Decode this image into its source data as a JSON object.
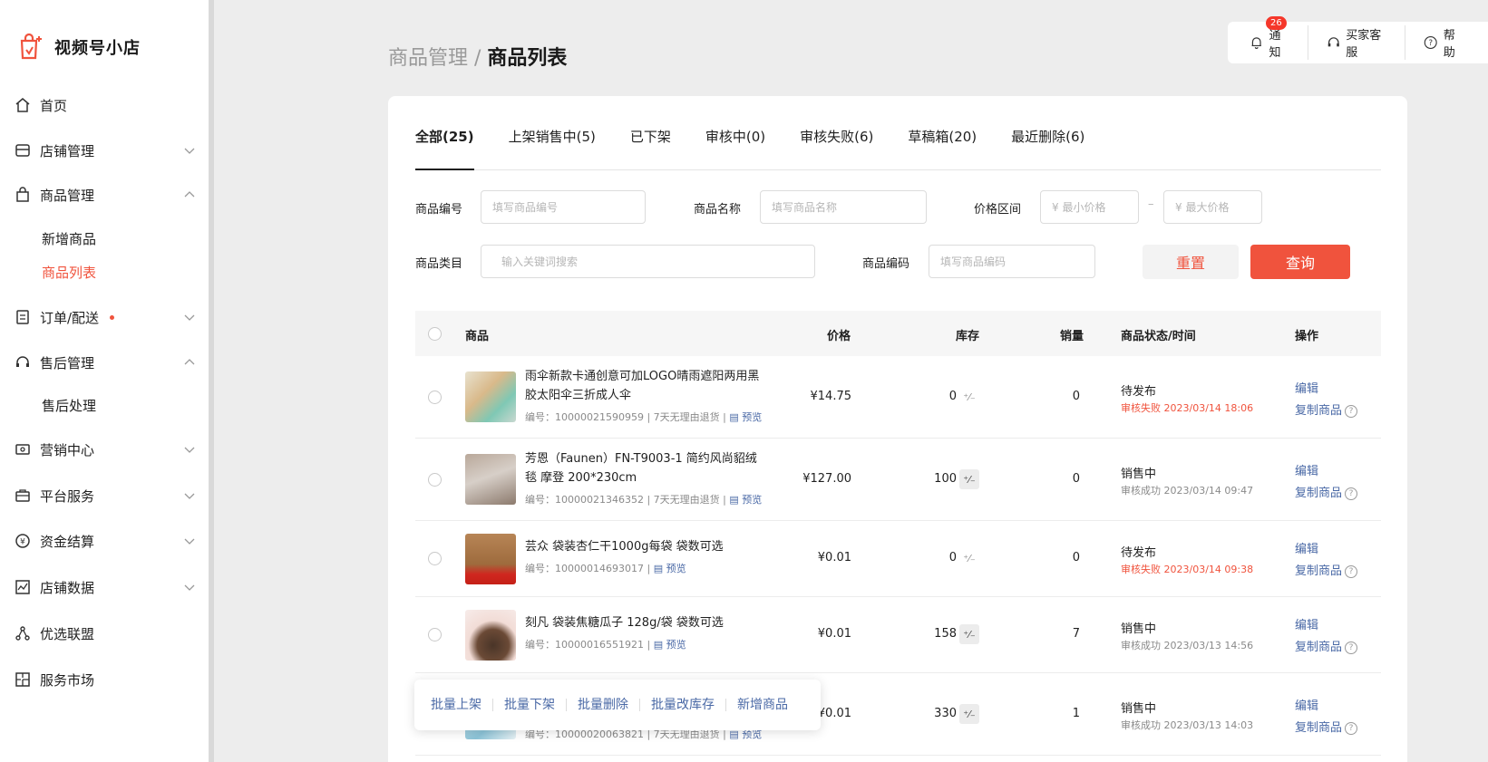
{
  "brand": {
    "name": "视频号小店"
  },
  "sidebar": {
    "items": [
      {
        "label": "首页"
      },
      {
        "label": "店铺管理"
      },
      {
        "label": "商品管理"
      },
      {
        "label": "订单/配送"
      },
      {
        "label": "售后管理"
      },
      {
        "label": "营销中心"
      },
      {
        "label": "平台服务"
      },
      {
        "label": "资金结算"
      },
      {
        "label": "店铺数据"
      },
      {
        "label": "优选联盟"
      },
      {
        "label": "服务市场"
      }
    ],
    "sub": {
      "product": [
        {
          "label": "新增商品"
        },
        {
          "label": "商品列表"
        }
      ],
      "aftersale": [
        {
          "label": "售后处理"
        }
      ]
    }
  },
  "topbar": {
    "notice": "通知",
    "notice_count": "26",
    "service": "买家客服",
    "help": "帮助"
  },
  "breadcrumb": {
    "parent": "商品管理",
    "sep": " / ",
    "current": "商品列表"
  },
  "tabs": [
    {
      "label": "全部(25)"
    },
    {
      "label": "上架销售中(5)"
    },
    {
      "label": "已下架"
    },
    {
      "label": "审核中(0)"
    },
    {
      "label": "审核失败(6)"
    },
    {
      "label": "草稿箱(20)"
    },
    {
      "label": "最近删除(6)"
    }
  ],
  "filters": {
    "id_label": "商品编号",
    "id_ph": "填写商品编号",
    "name_label": "商品名称",
    "name_ph": "填写商品名称",
    "price_label": "价格区间",
    "min_ph": "¥  最小价格",
    "dash": "–",
    "max_ph": "¥  最大价格",
    "cat_label": "商品类目",
    "cat_ph": "输入关键词搜索",
    "code_label": "商品编码",
    "code_ph": "填写商品编码",
    "reset": "重置",
    "query": "查询"
  },
  "table": {
    "headers": {
      "product": "商品",
      "price": "价格",
      "stock": "库存",
      "sales": "销量",
      "status": "商品状态/时间",
      "ops": "操作"
    },
    "rows": [
      {
        "name": "雨伞新款卡通创意可加LOGO晴雨遮阳两用黑胶太阳伞三折成人伞",
        "meta": "编号：10000021590959 | 7天无理由退货 |",
        "preview": "预览",
        "price": "¥14.75",
        "stock": "0",
        "sales": "0",
        "status": "待发布",
        "status_sub": "审核失败 2023/03/14 18:06",
        "edit": "编辑",
        "copy": "复制商品"
      },
      {
        "name": "芳恩（Faunen）FN-T9003-1 简约风尚貂绒毯 摩登 200*230cm",
        "meta": "编号：10000021346352 | 7天无理由退货 |",
        "preview": "预览",
        "price": "¥127.00",
        "stock": "100",
        "sales": "0",
        "status": "销售中",
        "status_sub": "审核成功 2023/03/14 09:47",
        "edit": "编辑",
        "copy": "复制商品"
      },
      {
        "name": "芸众 袋装杏仁干1000g每袋 袋数可选",
        "meta": "编号：10000014693017 |",
        "preview": "预览",
        "price": "¥0.01",
        "stock": "0",
        "sales": "0",
        "status": "待发布",
        "status_sub": "审核失败 2023/03/14 09:38",
        "edit": "编辑",
        "copy": "复制商品"
      },
      {
        "name": "刻凡 袋装焦糖瓜子 128g/袋 袋数可选",
        "meta": "编号：10000016551921 |",
        "preview": "预览",
        "price": "¥0.01",
        "stock": "158",
        "sales": "7",
        "status": "销售中",
        "status_sub": "审核成功 2023/03/13 14:56",
        "edit": "编辑",
        "copy": "复制商品"
      },
      {
        "name": "",
        "meta": "编号：10000020063821 | 7天无理由退货 |",
        "preview": "预览",
        "price": "¥0.01",
        "stock": "330",
        "sales": "1",
        "status": "销售中",
        "status_sub": "审核成功 2023/03/13 14:03",
        "edit": "编辑",
        "copy": "复制商品"
      }
    ]
  },
  "batch": {
    "up": "批量上架",
    "down": "批量下架",
    "del": "批量删除",
    "stock": "批量改库存",
    "add": "新增商品"
  },
  "colors": {
    "accent": "#f0533d",
    "link": "#4a69a6"
  }
}
